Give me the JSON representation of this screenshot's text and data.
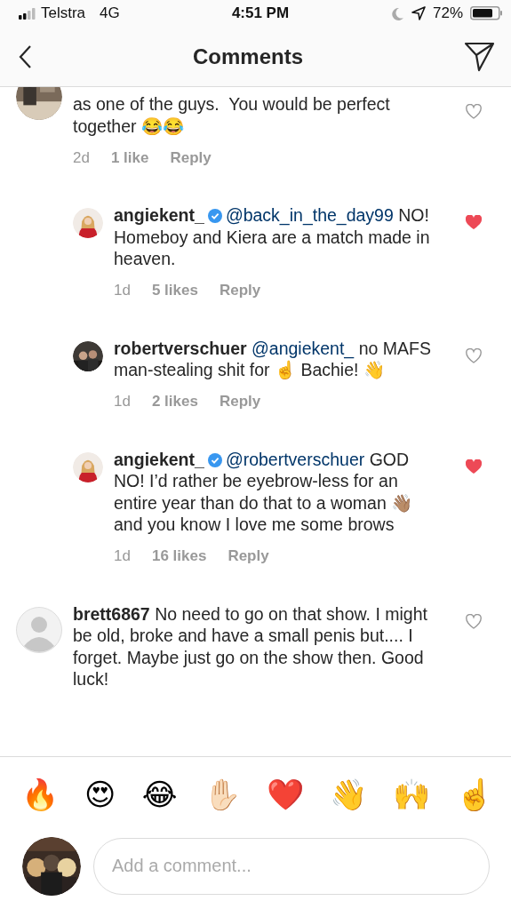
{
  "status_bar": {
    "carrier": "Telstra",
    "network": "4G",
    "time": "4:51 PM",
    "battery": "72%"
  },
  "header": {
    "title": "Comments"
  },
  "comments": [
    {
      "reply": false,
      "verified": false,
      "text": "as one of the guys.  You would be perfect together 😂😂",
      "time": "2d",
      "likes": "1 like",
      "reply_label": "Reply",
      "liked": false
    },
    {
      "reply": true,
      "username": "angiekent_",
      "verified": true,
      "mention": "@back_in_the_day99",
      "text": "NO! Homeboy and Kiera are a match made in heaven.",
      "time": "1d",
      "likes": "5 likes",
      "reply_label": "Reply",
      "liked": true
    },
    {
      "reply": true,
      "username": "robertverschuer",
      "verified": false,
      "mention": "@angiekent_",
      "text": "no MAFS man-stealing shit for ☝️ Bachie! 👋",
      "time": "1d",
      "likes": "2 likes",
      "reply_label": "Reply",
      "liked": false
    },
    {
      "reply": true,
      "username": "angiekent_",
      "verified": true,
      "mention": "@robertverschuer",
      "text": "GOD NO! I’d rather be eyebrow-less for an entire year than do that to a woman 👋🏽 and you know I love me some brows",
      "time": "1d",
      "likes": "16 likes",
      "reply_label": "Reply",
      "liked": true
    },
    {
      "reply": false,
      "avatar": {
        "kind": "placeholder"
      },
      "username": "brett6867",
      "verified": false,
      "text": "No need to go on that show. I might be old, broke and have a small penis but.... I forget. Maybe just go on the show then. Good luck!",
      "liked": false
    }
  ],
  "emoji_bar": [
    "🔥",
    "😍",
    "😂",
    "✋🏻",
    "❤️",
    "👋",
    "🙌",
    "☝️"
  ],
  "composer": {
    "placeholder": "Add a comment..."
  }
}
